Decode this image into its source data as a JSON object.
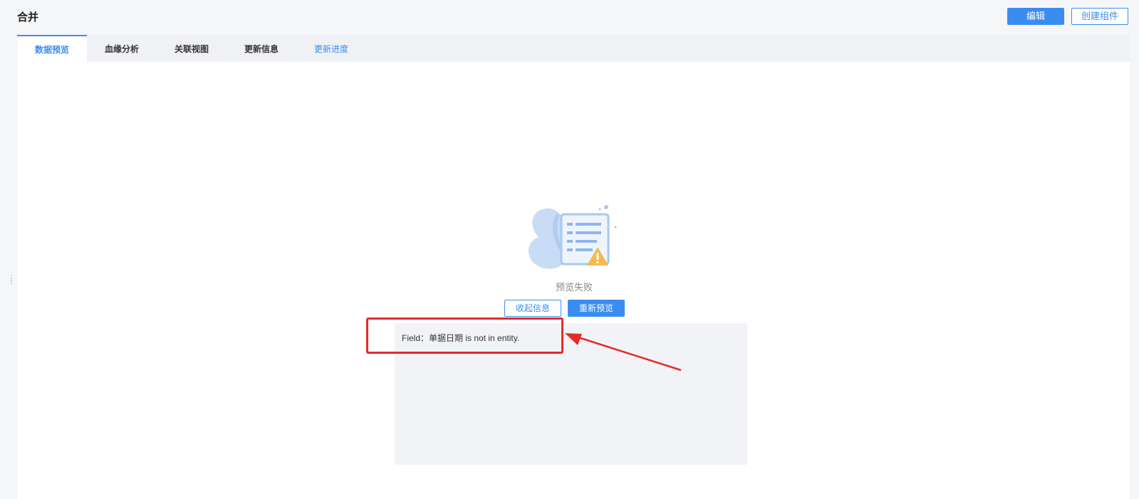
{
  "header": {
    "title": "合并",
    "edit_label": "编辑",
    "create_component_label": "创建组件"
  },
  "tabs": [
    {
      "label": "数据预览",
      "active": true
    },
    {
      "label": "血缘分析",
      "active": false
    },
    {
      "label": "关联视图",
      "active": false
    },
    {
      "label": "更新信息",
      "active": false
    },
    {
      "label": "更新进度",
      "active": false
    }
  ],
  "preview": {
    "status_text": "预览失败",
    "collapse_label": "收起信息",
    "repreview_label": "重新预览",
    "error_message": "Field：单据日期 is not in entity.",
    "illustration_icon": "preview-failed-illustration",
    "warning_color": "#f6b94e"
  },
  "colors": {
    "accent": "#3b8cf0",
    "annotation": "#e52a2a"
  }
}
